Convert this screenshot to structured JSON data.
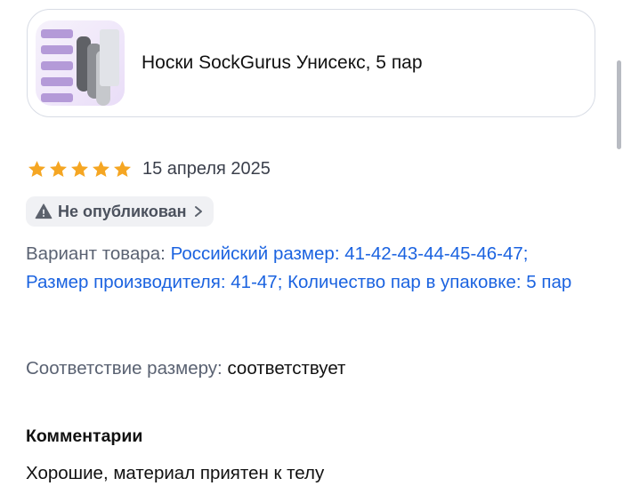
{
  "product": {
    "title": "Носки SockGurus Унисекс, 5 пар",
    "image_icon": "product-photo-socks"
  },
  "review": {
    "rating": 5,
    "rating_max": 5,
    "date": "15 апреля 2025",
    "star_color": "#f5a623",
    "status": {
      "label": "Не опубликован",
      "icon": "warning-icon",
      "chevron": "chevron-right-icon"
    },
    "variant": {
      "prefix": "Вариант товара:",
      "value": "Российский размер: 41-42-43-44-45-46-47; Размер производителя: 41-47; Количество пар в упаковке: 5 пар",
      "value_color": "#1b63e0"
    },
    "size_match": {
      "prefix": "Соответствие размеру:",
      "value": "соответствует"
    },
    "comments": {
      "heading": "Комментарии",
      "text": "Хорошие, материал приятен к телу"
    }
  }
}
